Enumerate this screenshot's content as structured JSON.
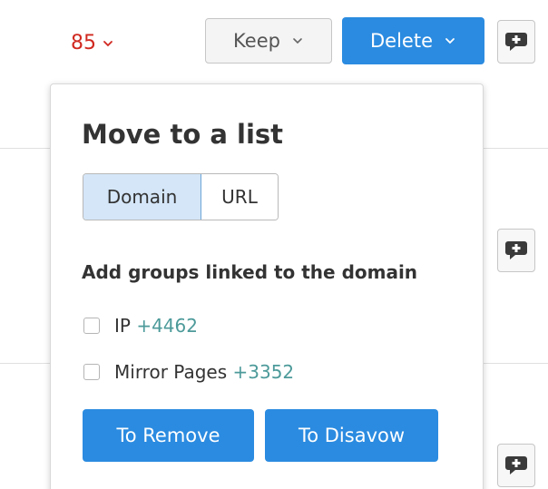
{
  "toolbar": {
    "score_value": "85",
    "score_color": "#d0281f",
    "keep_label": "Keep",
    "delete_label": "Delete",
    "accent_color": "#2b8be0"
  },
  "popup": {
    "title": "Move to a list",
    "segment": {
      "options": [
        "Domain",
        "URL"
      ],
      "selected": "Domain"
    },
    "section_label": "Add groups linked to the domain",
    "options": [
      {
        "label": "IP",
        "count": "+4462",
        "checked": false
      },
      {
        "label": "Mirror Pages",
        "count": "+3352",
        "checked": false
      }
    ],
    "remove_label": "To Remove",
    "disavow_label": "To Disavow"
  },
  "icons": {
    "comment": "comment-icon",
    "chevron": "chevron-down-icon"
  }
}
